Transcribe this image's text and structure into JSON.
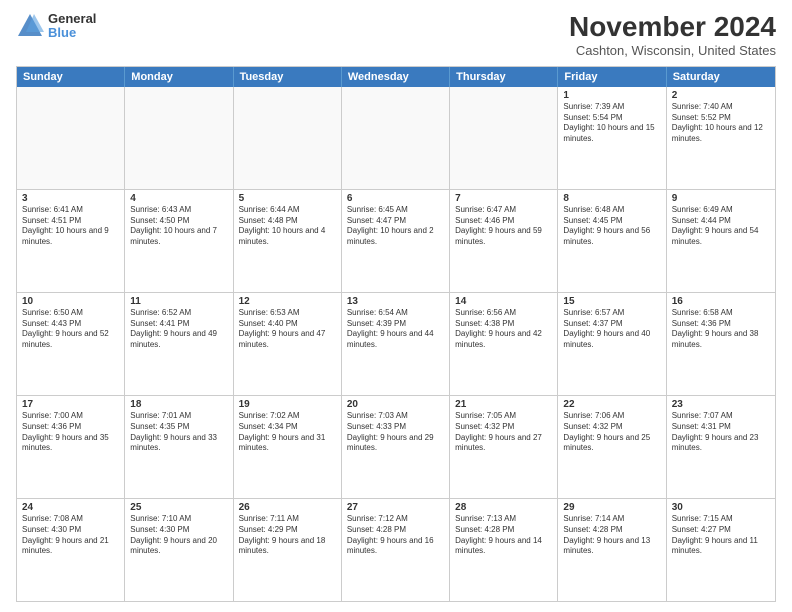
{
  "header": {
    "logo_general": "General",
    "logo_blue": "Blue",
    "title": "November 2024",
    "location": "Cashton, Wisconsin, United States"
  },
  "weekdays": [
    "Sunday",
    "Monday",
    "Tuesday",
    "Wednesday",
    "Thursday",
    "Friday",
    "Saturday"
  ],
  "rows": [
    [
      {
        "day": "",
        "info": ""
      },
      {
        "day": "",
        "info": ""
      },
      {
        "day": "",
        "info": ""
      },
      {
        "day": "",
        "info": ""
      },
      {
        "day": "",
        "info": ""
      },
      {
        "day": "1",
        "info": "Sunrise: 7:39 AM\nSunset: 5:54 PM\nDaylight: 10 hours and 15 minutes."
      },
      {
        "day": "2",
        "info": "Sunrise: 7:40 AM\nSunset: 5:52 PM\nDaylight: 10 hours and 12 minutes."
      }
    ],
    [
      {
        "day": "3",
        "info": "Sunrise: 6:41 AM\nSunset: 4:51 PM\nDaylight: 10 hours and 9 minutes."
      },
      {
        "day": "4",
        "info": "Sunrise: 6:43 AM\nSunset: 4:50 PM\nDaylight: 10 hours and 7 minutes."
      },
      {
        "day": "5",
        "info": "Sunrise: 6:44 AM\nSunset: 4:48 PM\nDaylight: 10 hours and 4 minutes."
      },
      {
        "day": "6",
        "info": "Sunrise: 6:45 AM\nSunset: 4:47 PM\nDaylight: 10 hours and 2 minutes."
      },
      {
        "day": "7",
        "info": "Sunrise: 6:47 AM\nSunset: 4:46 PM\nDaylight: 9 hours and 59 minutes."
      },
      {
        "day": "8",
        "info": "Sunrise: 6:48 AM\nSunset: 4:45 PM\nDaylight: 9 hours and 56 minutes."
      },
      {
        "day": "9",
        "info": "Sunrise: 6:49 AM\nSunset: 4:44 PM\nDaylight: 9 hours and 54 minutes."
      }
    ],
    [
      {
        "day": "10",
        "info": "Sunrise: 6:50 AM\nSunset: 4:43 PM\nDaylight: 9 hours and 52 minutes."
      },
      {
        "day": "11",
        "info": "Sunrise: 6:52 AM\nSunset: 4:41 PM\nDaylight: 9 hours and 49 minutes."
      },
      {
        "day": "12",
        "info": "Sunrise: 6:53 AM\nSunset: 4:40 PM\nDaylight: 9 hours and 47 minutes."
      },
      {
        "day": "13",
        "info": "Sunrise: 6:54 AM\nSunset: 4:39 PM\nDaylight: 9 hours and 44 minutes."
      },
      {
        "day": "14",
        "info": "Sunrise: 6:56 AM\nSunset: 4:38 PM\nDaylight: 9 hours and 42 minutes."
      },
      {
        "day": "15",
        "info": "Sunrise: 6:57 AM\nSunset: 4:37 PM\nDaylight: 9 hours and 40 minutes."
      },
      {
        "day": "16",
        "info": "Sunrise: 6:58 AM\nSunset: 4:36 PM\nDaylight: 9 hours and 38 minutes."
      }
    ],
    [
      {
        "day": "17",
        "info": "Sunrise: 7:00 AM\nSunset: 4:36 PM\nDaylight: 9 hours and 35 minutes."
      },
      {
        "day": "18",
        "info": "Sunrise: 7:01 AM\nSunset: 4:35 PM\nDaylight: 9 hours and 33 minutes."
      },
      {
        "day": "19",
        "info": "Sunrise: 7:02 AM\nSunset: 4:34 PM\nDaylight: 9 hours and 31 minutes."
      },
      {
        "day": "20",
        "info": "Sunrise: 7:03 AM\nSunset: 4:33 PM\nDaylight: 9 hours and 29 minutes."
      },
      {
        "day": "21",
        "info": "Sunrise: 7:05 AM\nSunset: 4:32 PM\nDaylight: 9 hours and 27 minutes."
      },
      {
        "day": "22",
        "info": "Sunrise: 7:06 AM\nSunset: 4:32 PM\nDaylight: 9 hours and 25 minutes."
      },
      {
        "day": "23",
        "info": "Sunrise: 7:07 AM\nSunset: 4:31 PM\nDaylight: 9 hours and 23 minutes."
      }
    ],
    [
      {
        "day": "24",
        "info": "Sunrise: 7:08 AM\nSunset: 4:30 PM\nDaylight: 9 hours and 21 minutes."
      },
      {
        "day": "25",
        "info": "Sunrise: 7:10 AM\nSunset: 4:30 PM\nDaylight: 9 hours and 20 minutes."
      },
      {
        "day": "26",
        "info": "Sunrise: 7:11 AM\nSunset: 4:29 PM\nDaylight: 9 hours and 18 minutes."
      },
      {
        "day": "27",
        "info": "Sunrise: 7:12 AM\nSunset: 4:28 PM\nDaylight: 9 hours and 16 minutes."
      },
      {
        "day": "28",
        "info": "Sunrise: 7:13 AM\nSunset: 4:28 PM\nDaylight: 9 hours and 14 minutes."
      },
      {
        "day": "29",
        "info": "Sunrise: 7:14 AM\nSunset: 4:28 PM\nDaylight: 9 hours and 13 minutes."
      },
      {
        "day": "30",
        "info": "Sunrise: 7:15 AM\nSunset: 4:27 PM\nDaylight: 9 hours and 11 minutes."
      }
    ]
  ]
}
